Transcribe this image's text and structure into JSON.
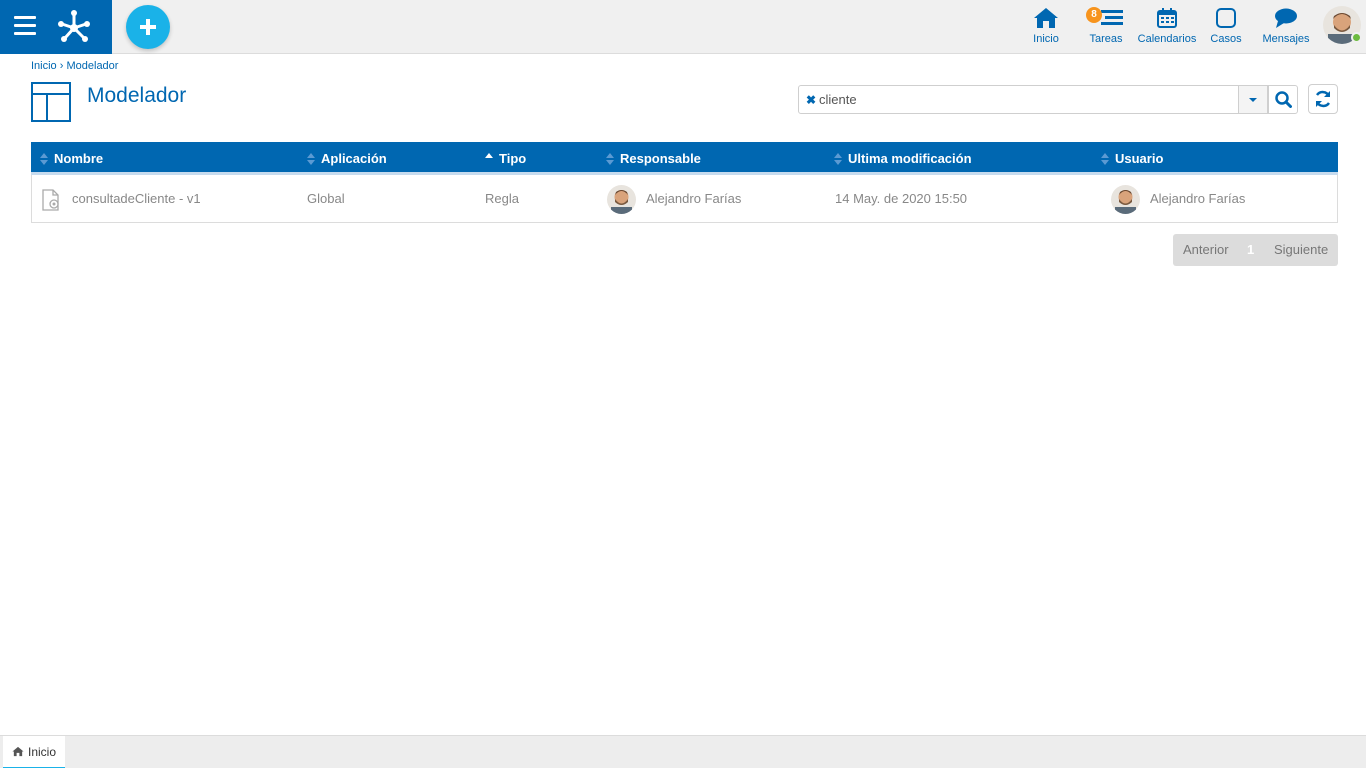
{
  "topbar": {
    "nav": [
      {
        "label": "Inicio",
        "icon": "home-icon"
      },
      {
        "label": "Tareas",
        "icon": "tasks-icon",
        "badge": "8"
      },
      {
        "label": "Calendarios",
        "icon": "calendar-icon"
      },
      {
        "label": "Casos",
        "icon": "cases-icon"
      },
      {
        "label": "Mensajes",
        "icon": "messages-icon"
      }
    ]
  },
  "breadcrumb": {
    "home": "Inicio",
    "separator": "›",
    "current": "Modelador"
  },
  "page": {
    "title": "Modelador"
  },
  "search": {
    "value": "cliente",
    "clear_icon": "close-icon"
  },
  "table": {
    "columns": [
      "Nombre",
      "Aplicación",
      "Tipo",
      "Responsable",
      "Ultima modificación",
      "Usuario"
    ],
    "rows": [
      {
        "nombre": "consultadeCliente - v1",
        "aplicacion": "Global",
        "tipo": "Regla",
        "responsable": "Alejandro Farías",
        "ultima_modificacion": "14 May. de 2020 15:50",
        "usuario": "Alejandro Farías"
      }
    ]
  },
  "pager": {
    "prev": "Anterior",
    "page": "1",
    "next": "Siguiente"
  },
  "bottom": {
    "tab": "Inicio"
  },
  "colors": {
    "brand": "#0067b1",
    "accent": "#1ab2e8",
    "badge": "#f7941d",
    "online": "#6dbb3f"
  }
}
